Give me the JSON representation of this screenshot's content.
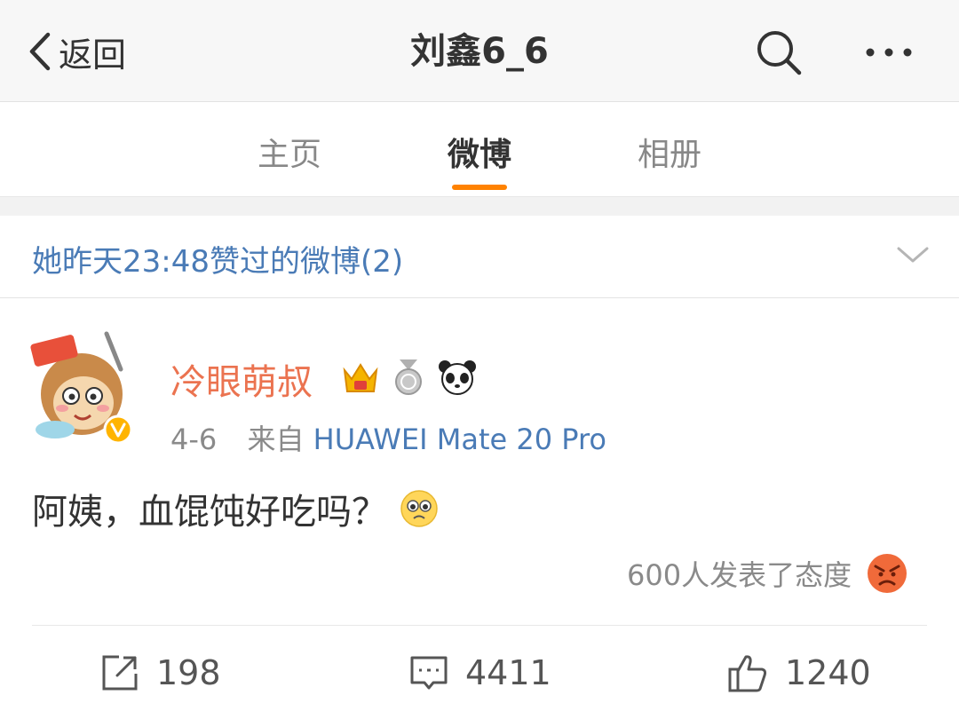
{
  "header": {
    "back_label": "返回",
    "title": "刘鑫6_6",
    "icons": [
      "chevron-left-icon",
      "search-icon",
      "more-icon"
    ]
  },
  "tabs": [
    {
      "label": "主页",
      "active": false
    },
    {
      "label": "微博",
      "active": true
    },
    {
      "label": "相册",
      "active": false
    }
  ],
  "colors": {
    "accent": "#ff8200",
    "link": "#4a7bb6",
    "username": "#eb7350",
    "muted": "#8a8a8a"
  },
  "liked_section": {
    "label": "她昨天23:48赞过的微博(2)"
  },
  "post": {
    "username": "冷眼萌叔",
    "badges": [
      "crown-badge-icon",
      "medal-badge-icon",
      "panda-badge-icon"
    ],
    "date": "4-6",
    "source_prefix": "来自",
    "source": "HUAWEI Mate 20 Pro",
    "text": "阿姨，血馄饨好吃吗？",
    "text_emoji": "pleading-face-emoji",
    "reaction_text": "600人发表了态度",
    "reaction_emoji": "angry-face-emoji",
    "actions": {
      "repost": "198",
      "comment": "4411",
      "like": "1240"
    }
  }
}
